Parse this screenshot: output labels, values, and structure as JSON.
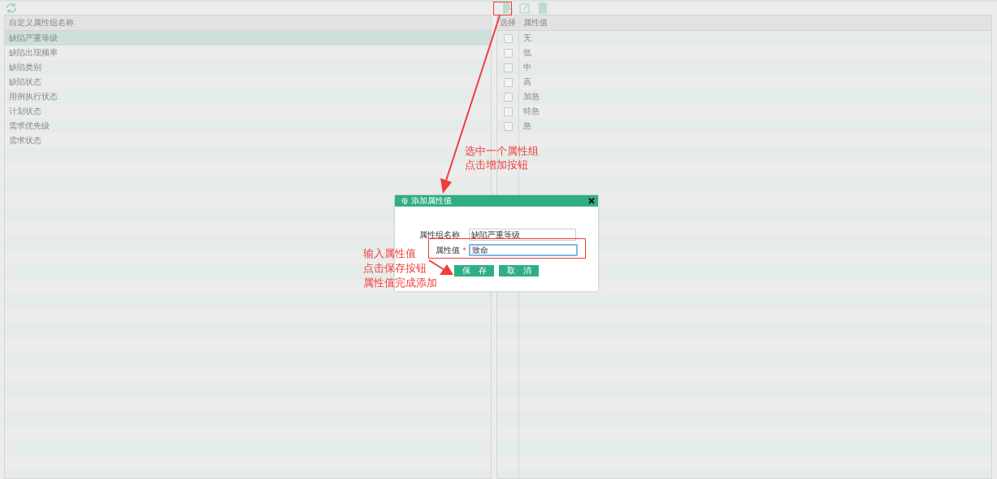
{
  "left_table": {
    "columns": [
      "自定义属性组名称"
    ],
    "rows": [
      {
        "name": "缺陷严重等级",
        "selected": true
      },
      {
        "name": "缺陷出现频率",
        "selected": false
      },
      {
        "name": "缺陷类别",
        "selected": false
      },
      {
        "name": "缺陷状态",
        "selected": false
      },
      {
        "name": "用例执行状态",
        "selected": false
      },
      {
        "name": "计划状态",
        "selected": false
      },
      {
        "name": "需求优先级",
        "selected": false
      },
      {
        "name": "需求状态",
        "selected": false
      }
    ]
  },
  "right_table": {
    "columns": [
      "选择",
      "属性值"
    ],
    "rows": [
      {
        "value": "无",
        "checked": false
      },
      {
        "value": "低",
        "checked": false
      },
      {
        "value": "中",
        "checked": false
      },
      {
        "value": "高",
        "checked": false
      },
      {
        "value": "加急",
        "checked": false
      },
      {
        "value": "特急",
        "checked": false
      },
      {
        "value": "急",
        "checked": false
      }
    ]
  },
  "dialog": {
    "title": "添加属性值",
    "fields": [
      {
        "label": "属性组名称",
        "value": "缺陷严重等级",
        "focused": false
      },
      {
        "label": "属性值",
        "value": "致命",
        "required_mark": "*",
        "focused": true
      }
    ],
    "buttons": [
      "保　存",
      "取　消"
    ]
  },
  "annotations": [
    {
      "lines": [
        "选中一个属性组",
        "点击增加按钮"
      ]
    },
    {
      "lines": [
        "输入属性值",
        "点击保存按钮",
        "属性值完成添加"
      ]
    }
  ]
}
